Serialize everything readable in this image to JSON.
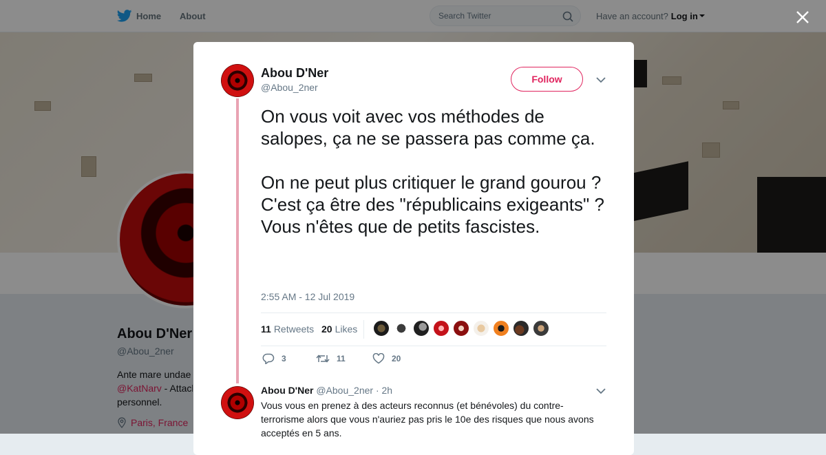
{
  "topbar": {
    "home_label": "Home",
    "about_label": "About",
    "search_placeholder": "Search Twitter",
    "account_prompt": "Have an account?",
    "login_label": "Log in"
  },
  "profile": {
    "name": "Abou D'Ner",
    "handle": "@Abou_2ner",
    "bio_start": "Ante mare undae",
    "bio_link": "@KatNarv",
    "bio_rest": " - Attach",
    "bio_line3": "personnel.",
    "location": "Paris, France"
  },
  "tweet": {
    "author_name": "Abou D'Ner",
    "author_handle": "@Abou_2ner",
    "follow_label": "Follow",
    "text": "On vous voit avec vos méthodes de salopes, ça ne se passera pas comme ça.\n\nOn ne peut plus critiquer le grand gourou ? C'est ça être des \"républicains exigeants\" ? Vous n'êtes que de petits fascistes.",
    "timestamp": "2:55 AM - 12 Jul 2019",
    "retweets_count": "11",
    "retweets_label": "Retweets",
    "likes_count": "20",
    "likes_label": "Likes",
    "reply_count": "3",
    "retweet_action_count": "11",
    "like_action_count": "20"
  },
  "reply": {
    "author_name": "Abou D'Ner",
    "author_handle": "@Abou_2ner",
    "time": "· 2h",
    "text": "Vous vous en prenez à des acteurs reconnus (et bénévoles) du contre-terrorisme alors que vous n'auriez pas pris le 10e des risques que nous avons acceptés en 5 ans."
  },
  "colors": {
    "accent": "#e0245e",
    "twitter_blue": "#1da1f2",
    "thread_line": "#e9a3b3",
    "secondary_text": "#657786"
  },
  "icons": [
    "twitter-bird-icon",
    "search-icon",
    "caret-down-icon",
    "close-icon",
    "chevron-down-icon",
    "reply-icon",
    "retweet-icon",
    "heart-icon",
    "location-pin-icon"
  ]
}
